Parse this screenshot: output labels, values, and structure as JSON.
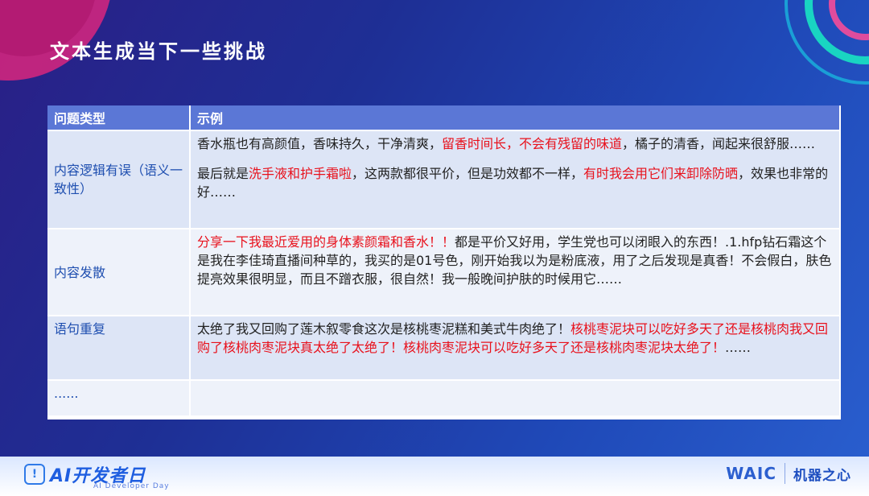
{
  "title": "文本生成当下一些挑战",
  "table": {
    "headers": [
      "问题类型",
      "示例"
    ],
    "rows": [
      {
        "type": "内容逻辑有误（语义一致性）",
        "p1": [
          {
            "t": "香水瓶也有高颜值，香味持久，干净清爽，",
            "red": false
          },
          {
            "t": "留香时间长，不会有残留的味道",
            "red": true
          },
          {
            "t": "，橘子的清香，闻起来很舒服……",
            "red": false
          }
        ],
        "p2": [
          {
            "t": "最后就是",
            "red": false
          },
          {
            "t": "洗手液和护手霜啦",
            "red": true
          },
          {
            "t": "，这两款都很平价，但是功效都不一样，",
            "red": false
          },
          {
            "t": "有时我会用它们来卸除防晒",
            "red": true
          },
          {
            "t": "，效果也非常的好……",
            "red": false
          }
        ]
      },
      {
        "type": "内容发散",
        "p1": [
          {
            "t": "分享一下我最近爱用的身体素颜霜和香水！！",
            "red": true
          },
          {
            "t": "都是平价又好用，学生党也可以闭眼入的东西！.1.hfp钻石霜这个是我在李佳琦直播间种草的，我买的是01号色，刚开始我以为是粉底液，用了之后发现是真香！不会假白，肤色提亮效果很明显，而且不蹭衣服，很自然！我一般晚间护肤的时候用它……",
            "red": false
          }
        ]
      },
      {
        "type": "语句重复",
        "p1": [
          {
            "t": "太绝了我又回购了莲木叙零食这次是核桃枣泥糕和美式牛肉绝了！",
            "red": false
          },
          {
            "t": "核桃枣泥块可以吃好多天了还是核桃肉我又回购了核桃肉枣泥块真太绝了太绝了！核桃肉枣泥块可以吃好多天了还是核桃肉枣泥块太绝了！",
            "red": true
          },
          {
            "t": "……",
            "red": false
          }
        ]
      }
    ],
    "more": "......"
  },
  "footer": {
    "left_logo_text": "AI开发者日",
    "left_logo_sub": "AI Developer Day",
    "waic": "WAIC",
    "right_logo_text": "机器之心"
  }
}
